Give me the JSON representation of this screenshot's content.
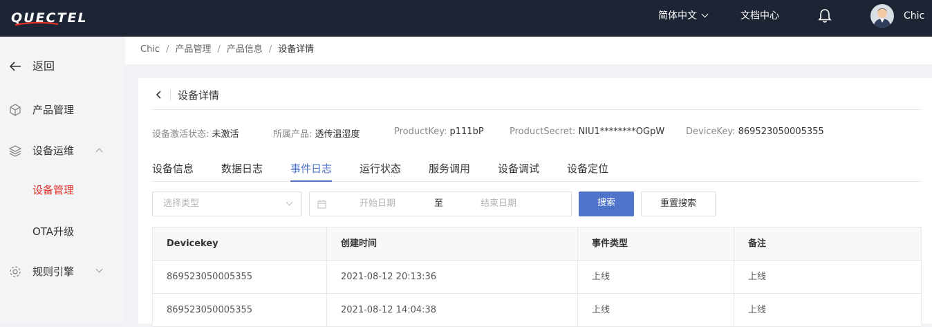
{
  "header": {
    "logo_text": "QUECTEL",
    "language": "简体中文",
    "docs": "文档中心",
    "user": "Chic"
  },
  "sidebar": {
    "back": "返回",
    "items": [
      {
        "label": "产品管理"
      },
      {
        "label": "设备运维"
      },
      {
        "label": "设备管理"
      },
      {
        "label": "OTA升级"
      },
      {
        "label": "规则引擎"
      }
    ]
  },
  "breadcrumb": [
    "Chic",
    "产品管理",
    "产品信息",
    "设备详情"
  ],
  "breadcrumb_sep": "/",
  "page_title": "设备详情",
  "info": [
    {
      "key": "设备激活状态: ",
      "value": "未激活"
    },
    {
      "key": "所属产品: ",
      "value": "透传温湿度"
    },
    {
      "key": "ProductKey: ",
      "value": "p111bP"
    },
    {
      "key": "ProductSecret: ",
      "value": "NIU1********OGpW"
    },
    {
      "key": "DeviceKey: ",
      "value": "869523050005355"
    }
  ],
  "tabs": [
    "设备信息",
    "数据日志",
    "事件日志",
    "运行状态",
    "服务调用",
    "设备调试",
    "设备定位"
  ],
  "active_tab": "事件日志",
  "filters": {
    "type_placeholder": "选择类型",
    "start_placeholder": "开始日期",
    "range_sep": "至",
    "end_placeholder": "结束日期",
    "search": "搜索",
    "reset": "重置搜索"
  },
  "table": {
    "headers": [
      "Devicekey",
      "创建时间",
      "事件类型",
      "备注"
    ],
    "rows": [
      [
        "869523050005355",
        "2021-08-12 20:13:36",
        "上线",
        "上线"
      ],
      [
        "869523050005355",
        "2021-08-12 14:04:38",
        "上线",
        "上线"
      ]
    ]
  },
  "colors": {
    "topbar": "#1d2433",
    "accent": "#4f74c9",
    "active_menu": "#e0322b"
  }
}
